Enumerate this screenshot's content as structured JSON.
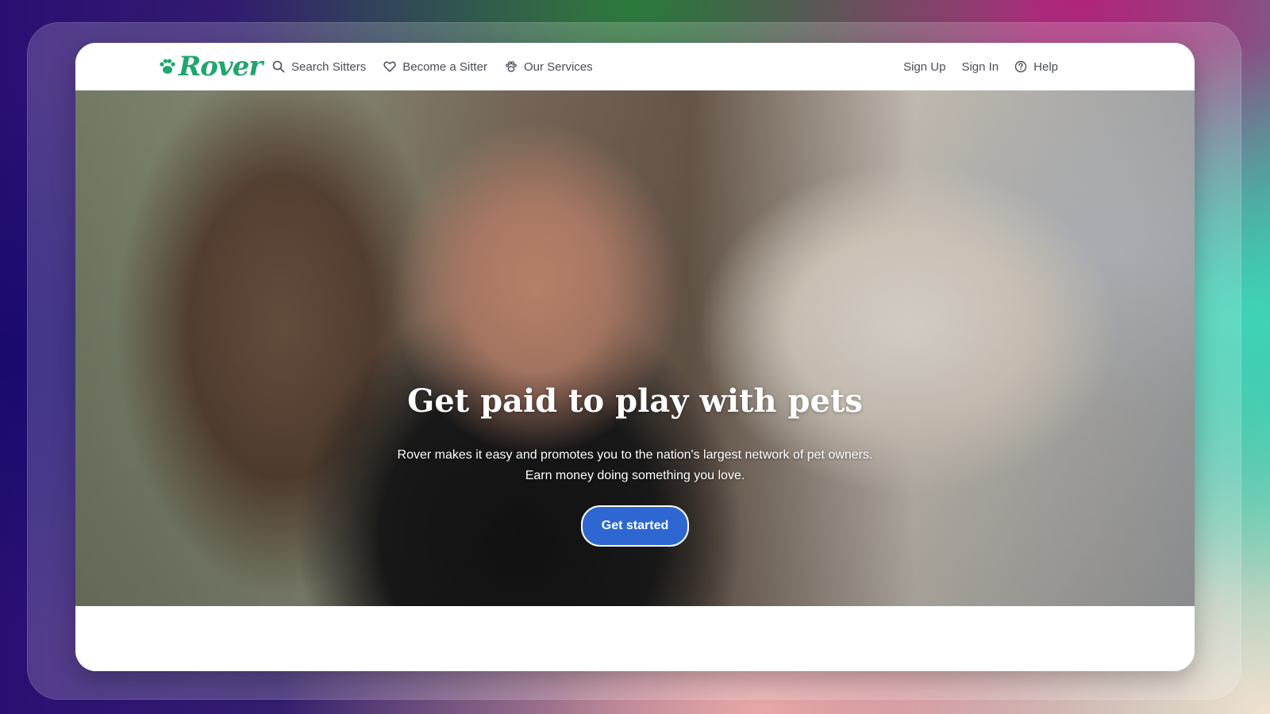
{
  "brand": {
    "name": "Rover",
    "color": "#1fa66c"
  },
  "nav": {
    "left": [
      {
        "label": "Search Sitters",
        "icon": "search-icon"
      },
      {
        "label": "Become a Sitter",
        "icon": "heart-icon"
      },
      {
        "label": "Our Services",
        "icon": "paw-icon"
      }
    ],
    "right": [
      {
        "label": "Sign Up"
      },
      {
        "label": "Sign In"
      },
      {
        "label": "Help",
        "icon": "help-circle-icon"
      }
    ]
  },
  "hero": {
    "title": "Get paid to play with pets",
    "subtitle_line1": "Rover makes it easy and promotes you to the nation's largest network of pet owners.",
    "subtitle_line2": "Earn money doing something you love.",
    "cta_label": "Get started",
    "cta_color": "#2e67d1"
  }
}
